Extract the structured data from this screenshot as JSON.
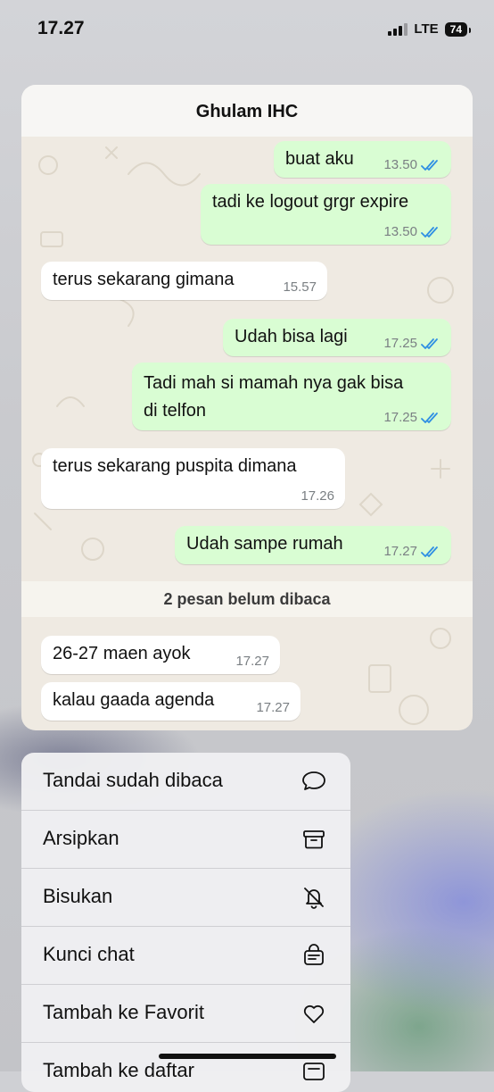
{
  "status_bar": {
    "time": "17.27",
    "network": "LTE",
    "battery": "74"
  },
  "chat": {
    "title": "Ghulam IHC",
    "messages": [
      {
        "dir": "out",
        "text": "buat aku",
        "time": "13.50",
        "read": true
      },
      {
        "dir": "out",
        "text": "tadi ke logout grgr expire",
        "time": "13.50",
        "read": true
      },
      {
        "dir": "in",
        "text": "terus sekarang gimana",
        "time": "15.57"
      },
      {
        "dir": "out",
        "text": "Udah bisa lagi",
        "time": "17.25",
        "read": true
      },
      {
        "dir": "out",
        "text_lines": [
          "Tadi mah si mamah nya gak bisa",
          "di telfon"
        ],
        "time": "17.25",
        "read": true
      },
      {
        "dir": "in",
        "text": "terus sekarang puspita dimana",
        "time": "17.26"
      },
      {
        "dir": "out",
        "text": "Udah sampe rumah",
        "time": "17.27",
        "read": true
      },
      {
        "dir": "in",
        "text": "26-27 maen ayok",
        "time": "17.27"
      },
      {
        "dir": "in",
        "text": "kalau gaada agenda",
        "time": "17.27"
      }
    ],
    "unread_banner": "2 pesan belum dibaca"
  },
  "menu": {
    "items": [
      {
        "label": "Tandai sudah dibaca",
        "icon": "chat-bubble-icon"
      },
      {
        "label": "Arsipkan",
        "icon": "archive-icon"
      },
      {
        "label": "Bisukan",
        "icon": "bell-slash-icon"
      },
      {
        "label": "Kunci chat",
        "icon": "lock-chat-icon"
      },
      {
        "label": "Tambah ke Favorit",
        "icon": "heart-icon"
      },
      {
        "label": "Tambah ke daftar",
        "icon": "list-add-icon"
      }
    ]
  },
  "colors": {
    "outgoing_bubble": "#d9fdd3",
    "incoming_bubble": "#ffffff",
    "read_tick": "#2f8fe3",
    "chat_bg": "#efeae2"
  }
}
